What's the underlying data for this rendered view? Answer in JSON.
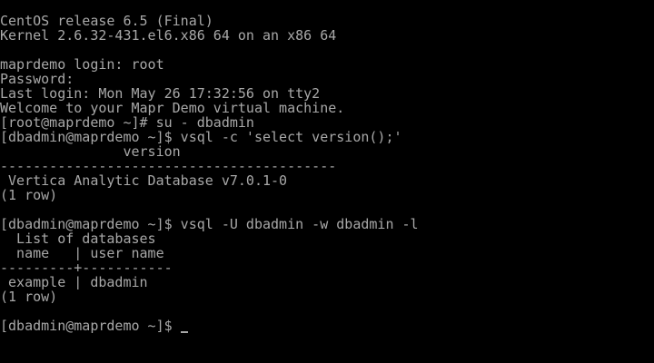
{
  "terminal": {
    "lines": [
      "CentOS release 6.5 (Final)",
      "Kernel 2.6.32-431.el6.x86_64 on an x86_64",
      "",
      "maprdemo login: root",
      "Password:",
      "Last login: Mon May 26 17:32:56 on tty2",
      "Welcome to your Mapr Demo virtual machine.",
      "[root@maprdemo ~]# su - dbadmin",
      "[dbadmin@maprdemo ~]$ vsql -c 'select version();'",
      "               version",
      "-----------------------------------------",
      " Vertica Analytic Database v7.0.1-0",
      "(1 row)",
      "",
      "[dbadmin@maprdemo ~]$ vsql -U dbadmin -w dbadmin -l",
      "  List of databases",
      "  name   | user_name",
      "---------+-----------",
      " example | dbadmin",
      "(1 row)",
      ""
    ],
    "prompt": "[dbadmin@maprdemo ~]$ "
  },
  "colors": {
    "background": "#000000",
    "foreground": "#a8a8a8"
  }
}
